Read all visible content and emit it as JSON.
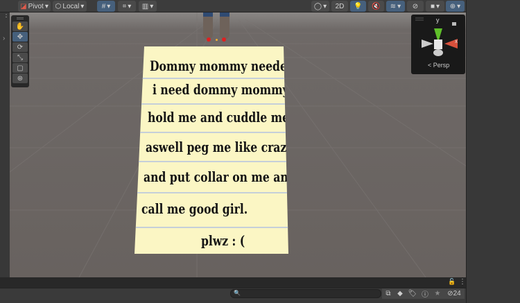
{
  "toolbar": {
    "pivot": "Pivot",
    "local": "Local",
    "mode_2d": "2D"
  },
  "gizmo": {
    "y": "y",
    "x": "x",
    "projection": "Persp"
  },
  "note": {
    "lines": [
      "Dommy mommy needed!",
      "i need dommy mommy",
      "hold me and cuddle me",
      "aswell peg me like crazy",
      "and put collar on me and",
      "call me good girl.",
      "plwz : ("
    ]
  },
  "bottom": {
    "hidden_count": "24"
  },
  "colors": {
    "accent": "#46607c",
    "paper": "#fbf6c4"
  }
}
